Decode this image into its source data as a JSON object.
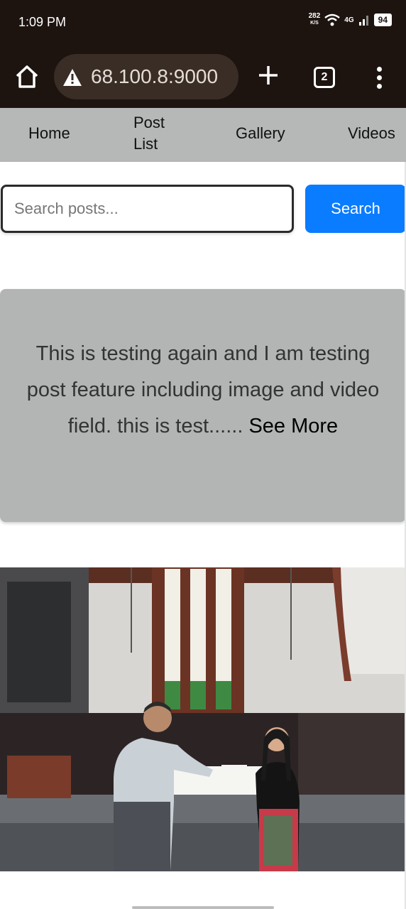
{
  "status_bar": {
    "time": "1:09 PM",
    "net_speed": "282",
    "net_speed_unit": "K/S",
    "network": "4G",
    "battery": "94"
  },
  "browser": {
    "address": "68.100.8:9000",
    "tab_count": "2",
    "icons": [
      "home-icon",
      "warning-icon",
      "plus-icon",
      "tabs-icon",
      "more-vert-icon"
    ]
  },
  "nav": {
    "items": [
      "Home",
      "Post List",
      "Gallery",
      "Videos"
    ]
  },
  "search": {
    "placeholder": "Search posts...",
    "button_label": "Search"
  },
  "post": {
    "text": "This is testing again and I am testing post feature including image and video field. this is test......",
    "see_more": "See More"
  },
  "colors": {
    "browser_chrome": "#1d1410",
    "navbar": "#b5b8b7",
    "search_button": "#0a7cff",
    "card": "#b2b5b4"
  }
}
